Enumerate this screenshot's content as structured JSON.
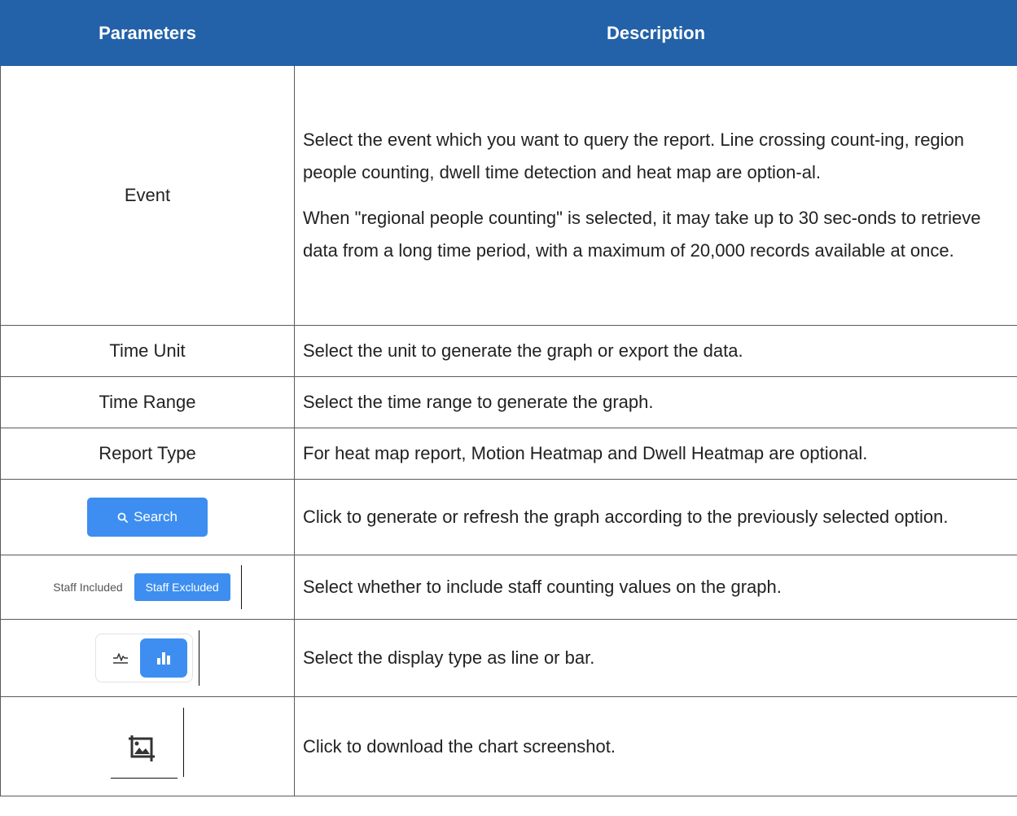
{
  "table": {
    "headers": {
      "parameters": "Parameters",
      "description": "Description"
    },
    "rows": {
      "event": {
        "param": "Event",
        "desc1": "Select the event which you want to query the report. Line crossing count-ing, region people counting, dwell time detection and heat map are option-al.",
        "desc2": "When \"regional people counting\" is selected, it may take up to 30 sec-onds to retrieve data from a long time period, with a maximum of 20,000 records available at once."
      },
      "time_unit": {
        "param": "Time Unit",
        "desc": "Select the unit to generate the graph or export the data."
      },
      "time_range": {
        "param": "Time Range",
        "desc": "Select the time range to generate the graph."
      },
      "report_type": {
        "param": "Report Type",
        "desc": "For heat map report, Motion Heatmap and Dwell Heatmap are optional."
      },
      "search": {
        "button_label": "Search",
        "icon": "search-icon",
        "desc": "Click to generate or refresh the graph according to the previously selected option."
      },
      "staff": {
        "included_label": "Staff Included",
        "excluded_label": "Staff Excluded",
        "desc": "Select whether to include staff counting values on the graph."
      },
      "chart_type": {
        "line_icon": "line-chart-icon",
        "bar_icon": "bar-chart-icon",
        "desc": "Select the display type as line or bar."
      },
      "screenshot": {
        "icon": "image-crop-icon",
        "desc": "Click to download the chart screenshot."
      }
    }
  },
  "colors": {
    "header_bg": "#2362a8",
    "header_text": "#ffffff",
    "accent": "#3d8ef0",
    "border": "#5a5a5a"
  }
}
